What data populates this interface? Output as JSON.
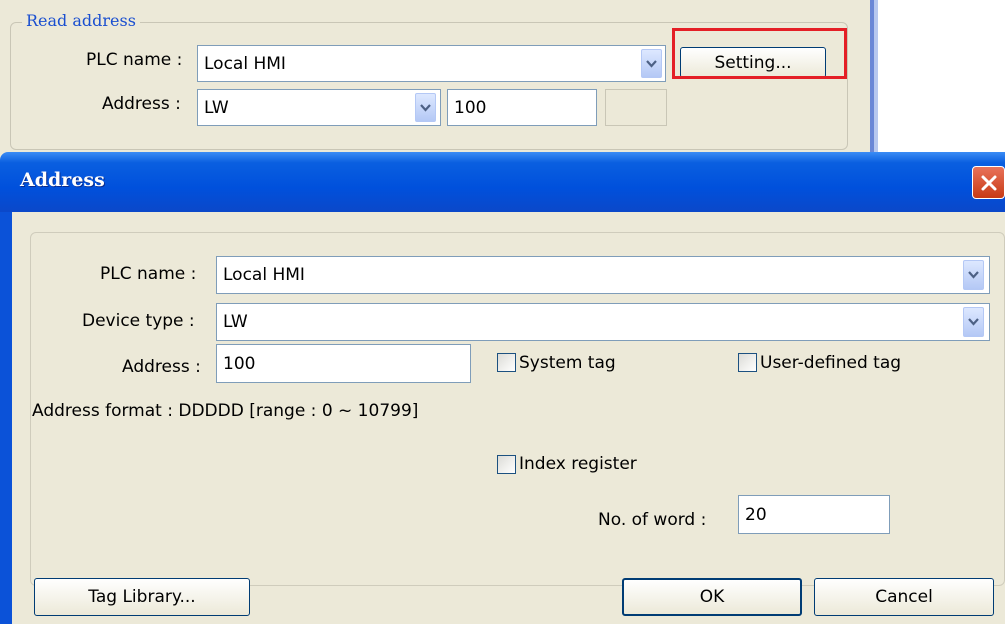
{
  "read_address": {
    "group_label": "Read address",
    "plc_name_label": "PLC name :",
    "plc_name_value": "Local HMI",
    "setting_button": "Setting...",
    "address_label": "Address :",
    "device_value": "LW",
    "address_value": "100",
    "extra_value": ""
  },
  "dialog": {
    "title": "Address",
    "plc_name_label": "PLC name :",
    "plc_name_value": "Local HMI",
    "device_type_label": "Device type :",
    "device_type_value": "LW",
    "address_label": "Address :",
    "address_value": "100",
    "system_tag_label": "System tag",
    "system_tag_checked": false,
    "user_defined_tag_label": "User-defined tag",
    "user_defined_tag_checked": false,
    "address_format": "Address format : DDDDD [range : 0 ~ 10799]",
    "index_register_label": "Index register",
    "index_register_checked": false,
    "no_of_word_label": "No. of word :",
    "no_of_word_value": "20",
    "tag_library_button": "Tag Library...",
    "ok_button": "OK",
    "cancel_button": "Cancel"
  },
  "colors": {
    "highlight": "#e41f26",
    "titlebar": "#0050dc",
    "window_bg": "#ece9d8",
    "legend_text": "#1a4fd0"
  },
  "icons": [
    "chevron-down-icon",
    "close-icon"
  ]
}
